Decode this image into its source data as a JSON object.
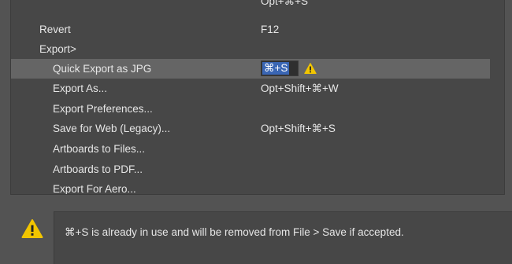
{
  "shortcut_list": {
    "rows": [
      {
        "command": "",
        "shortcut": "Opt+⌘+S"
      },
      {
        "command": "Revert",
        "shortcut": "F12"
      },
      {
        "command": "Export>",
        "shortcut": ""
      },
      {
        "command": "Quick Export as JPG",
        "shortcut": "⌘+S"
      },
      {
        "command": "Export As...",
        "shortcut": "Opt+Shift+⌘+W"
      },
      {
        "command": "Export Preferences...",
        "shortcut": ""
      },
      {
        "command": "Save for Web (Legacy)...",
        "shortcut": "Opt+Shift+⌘+S"
      },
      {
        "command": "Artboards to Files...",
        "shortcut": ""
      },
      {
        "command": "Artboards to PDF...",
        "shortcut": ""
      },
      {
        "command": "Export For Aero...",
        "shortcut": ""
      }
    ],
    "selected_row": "Quick Export as JPG"
  },
  "conflict": {
    "icon": "warning-icon",
    "message": "⌘+S is already in use and will be removed from File > Save if accepted."
  },
  "colors": {
    "background": "#535353",
    "panel": "#474747",
    "selected_row": "#656565",
    "text_selection": "#3a66b4",
    "warning": "#f2c500"
  }
}
